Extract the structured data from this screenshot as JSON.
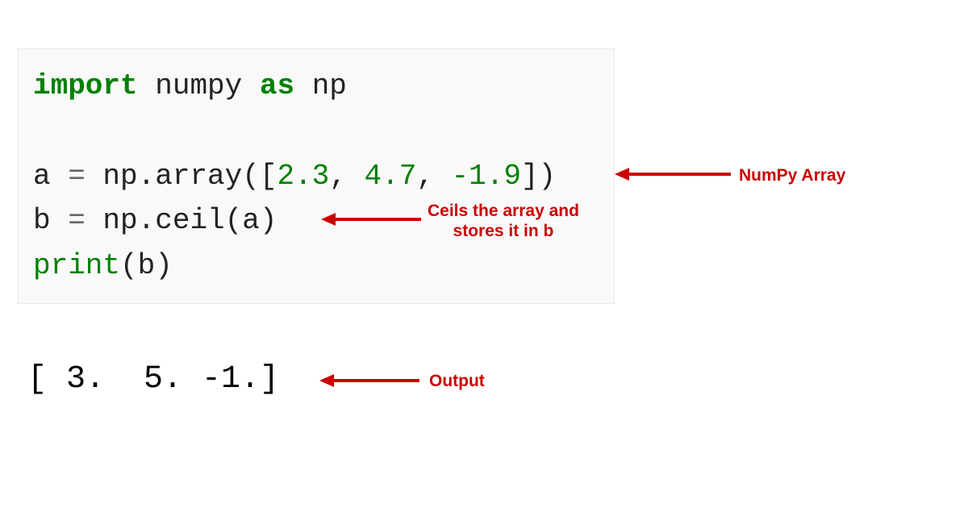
{
  "code": {
    "line1": {
      "kw_import": "import",
      "sp1": " ",
      "module": "numpy",
      "sp2": " ",
      "kw_as": "as",
      "sp3": " ",
      "alias": "np"
    },
    "line2": "",
    "line3": {
      "var": "a ",
      "eq": "=",
      "rest1": " np.array([",
      "n1": "2.3",
      "c1": ", ",
      "n2": "4.7",
      "c2": ", ",
      "n3": "-1.9",
      "close": "])"
    },
    "line4": {
      "var": "b ",
      "eq": "=",
      "rest": " np.ceil(a)"
    },
    "line5": {
      "fn": "print",
      "args": "(b)"
    }
  },
  "output": "[ 3.  5. -1.]",
  "annotations": {
    "numpy_array": "NumPy Array",
    "ceil_l1": "Ceils the array and",
    "ceil_l2": "stores it in b",
    "output": "Output"
  }
}
